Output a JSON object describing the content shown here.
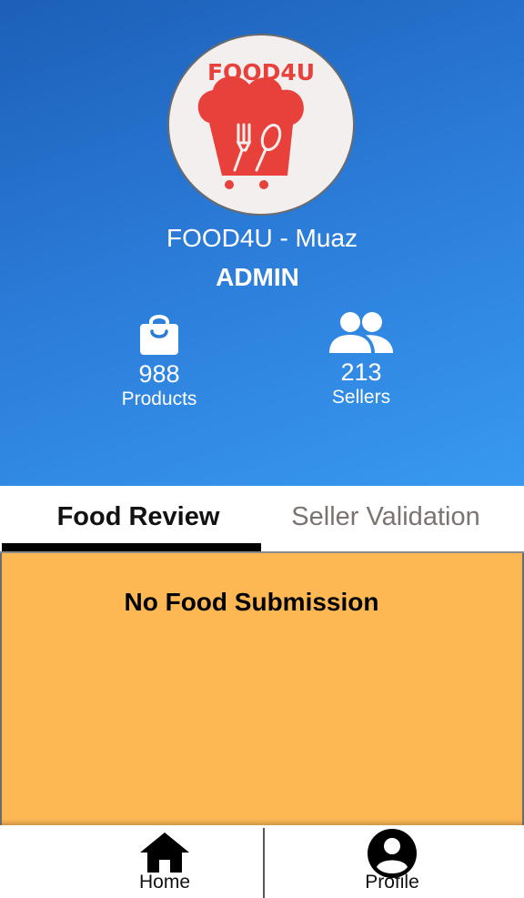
{
  "header": {
    "logo_text": "FOOD4U",
    "shop_name": "FOOD4U - Muaz",
    "role": "ADMIN",
    "stats": {
      "products": {
        "value": "988",
        "label": "Products",
        "icon": "shopping-bag-icon"
      },
      "sellers": {
        "value": "213",
        "label": "Sellers",
        "icon": "people-icon"
      }
    }
  },
  "tabs": [
    {
      "label": "Food Review",
      "active": true
    },
    {
      "label": "Seller Validation",
      "active": false
    }
  ],
  "content": {
    "empty_message": "No Food Submission"
  },
  "bottom_nav": [
    {
      "label": "Home",
      "icon": "home-icon"
    },
    {
      "label": "Profile",
      "icon": "account-circle-icon"
    }
  ],
  "colors": {
    "header_gradient_start": "#1c5fb8",
    "header_gradient_end": "#3899f0",
    "content_background": "#fdb854",
    "logo_red": "#e8403a",
    "active_tab_indicator": "#000000",
    "inactive_tab_text": "#7c7371"
  }
}
